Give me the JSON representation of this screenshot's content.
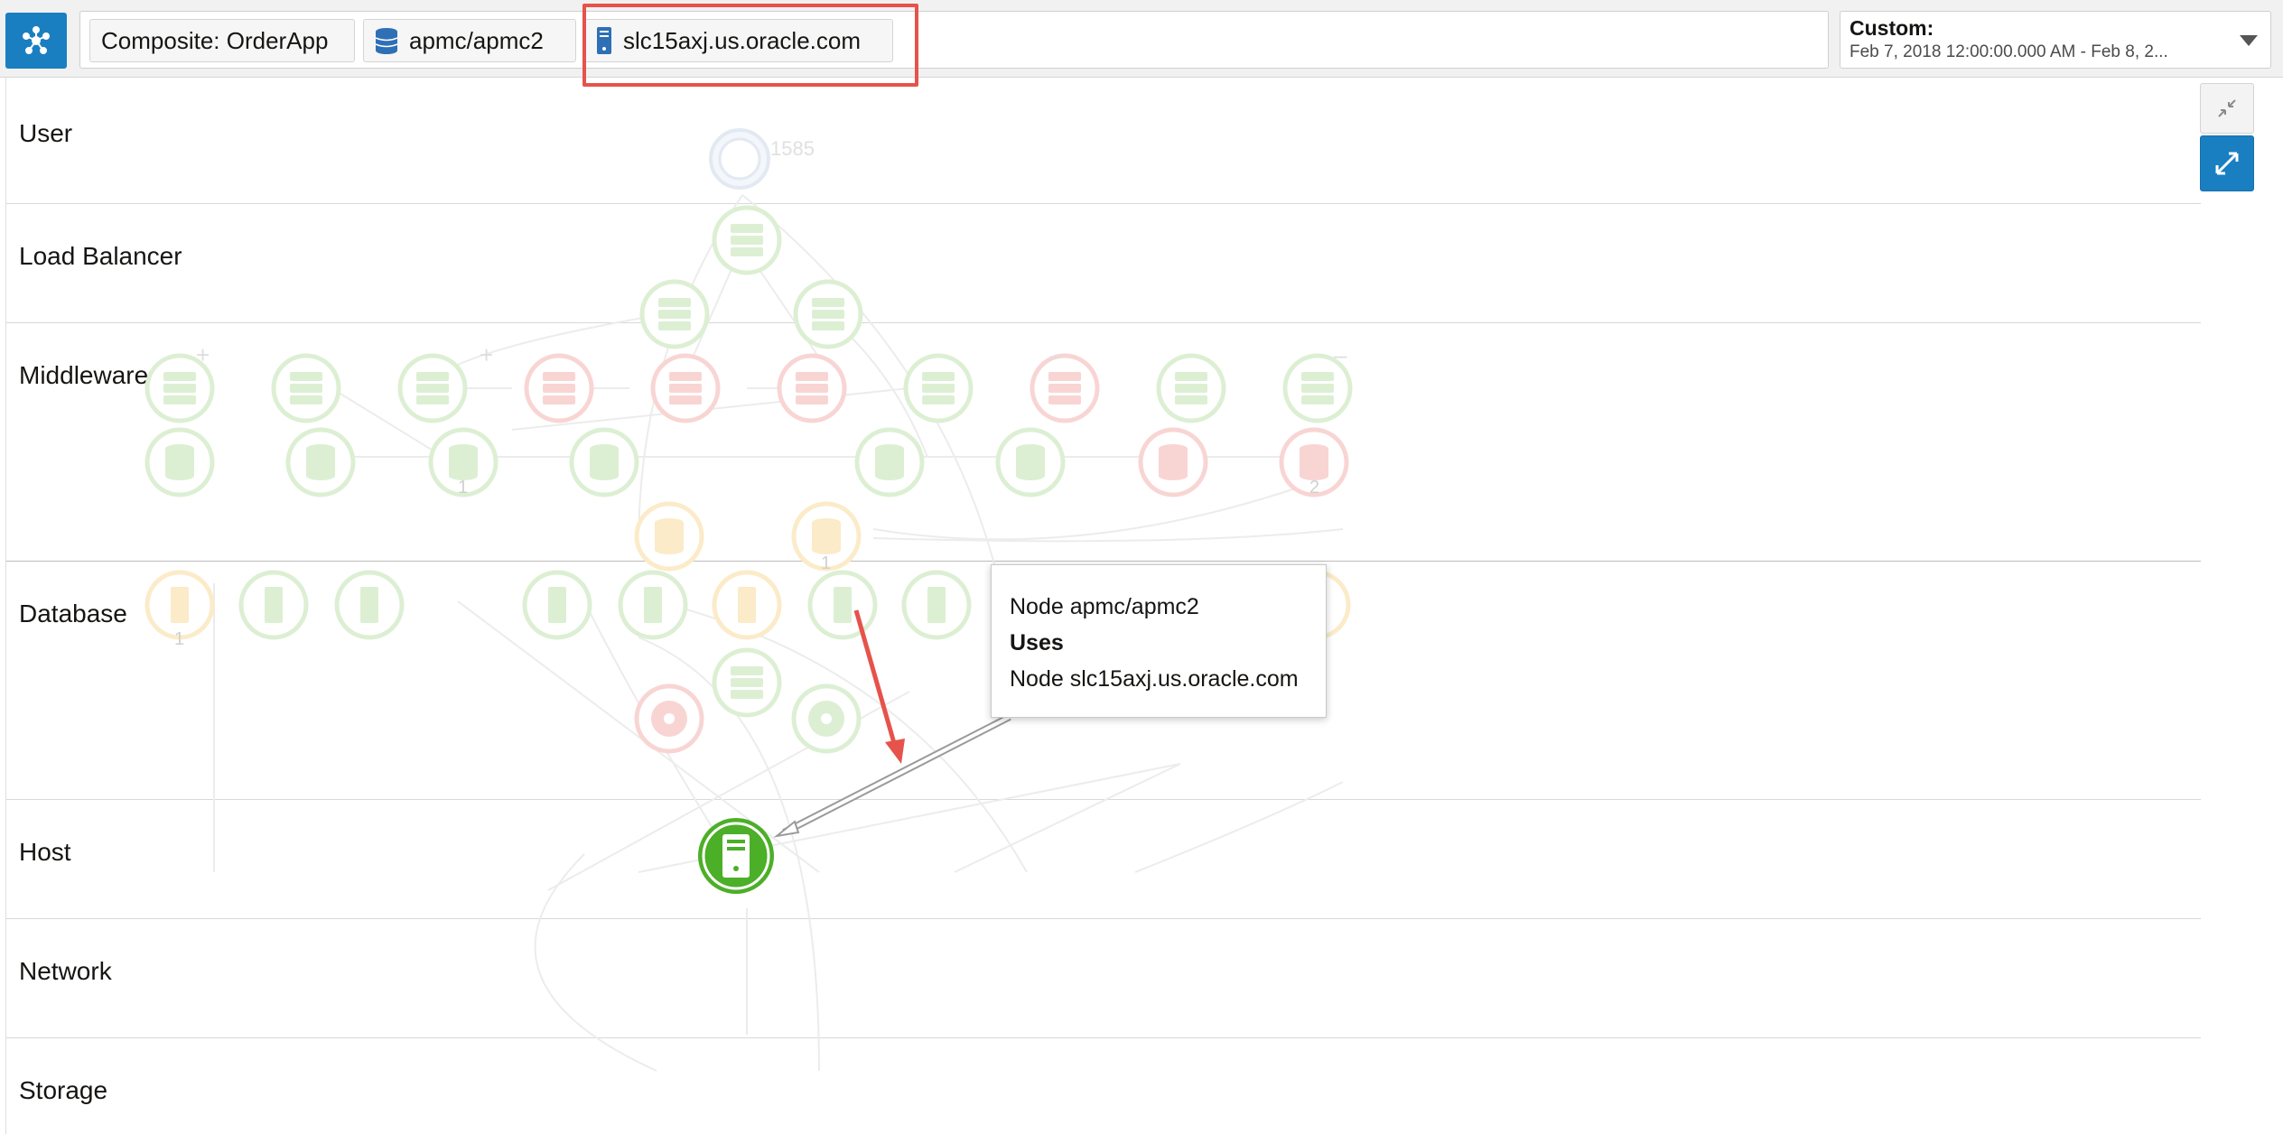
{
  "toolbar": {
    "app_icon": "topology-icon",
    "chips": [
      {
        "label": "Composite: OrderApp",
        "icon": null
      },
      {
        "label": "apmc/apmc2",
        "icon": "database-icon"
      },
      {
        "label": "slc15axj.us.oracle.com",
        "icon": "host-server-icon"
      }
    ],
    "clear_icon": "×",
    "time_label": "Custom:",
    "time_range": "Feb 7, 2018 12:00:00.000 AM - Feb 8, 2..."
  },
  "lanes": [
    "User",
    "Load Balancer",
    "Middleware",
    "Database",
    "Host",
    "Network",
    "Storage"
  ],
  "node_badges": {
    "user_count": "1585",
    "db_first": "1",
    "db_last": "2",
    "db_orange": "1",
    "host_first": "1"
  },
  "tooltip": {
    "line1": "Node apmc/apmc2",
    "line2": "Uses",
    "line3": "Node slc15axj.us.oracle.com"
  },
  "colors": {
    "accent": "#1a7fc1",
    "highlight": "#e5534b",
    "status_green": "#4caf28",
    "status_red": "#e5534b",
    "status_orange": "#e8b23a"
  }
}
